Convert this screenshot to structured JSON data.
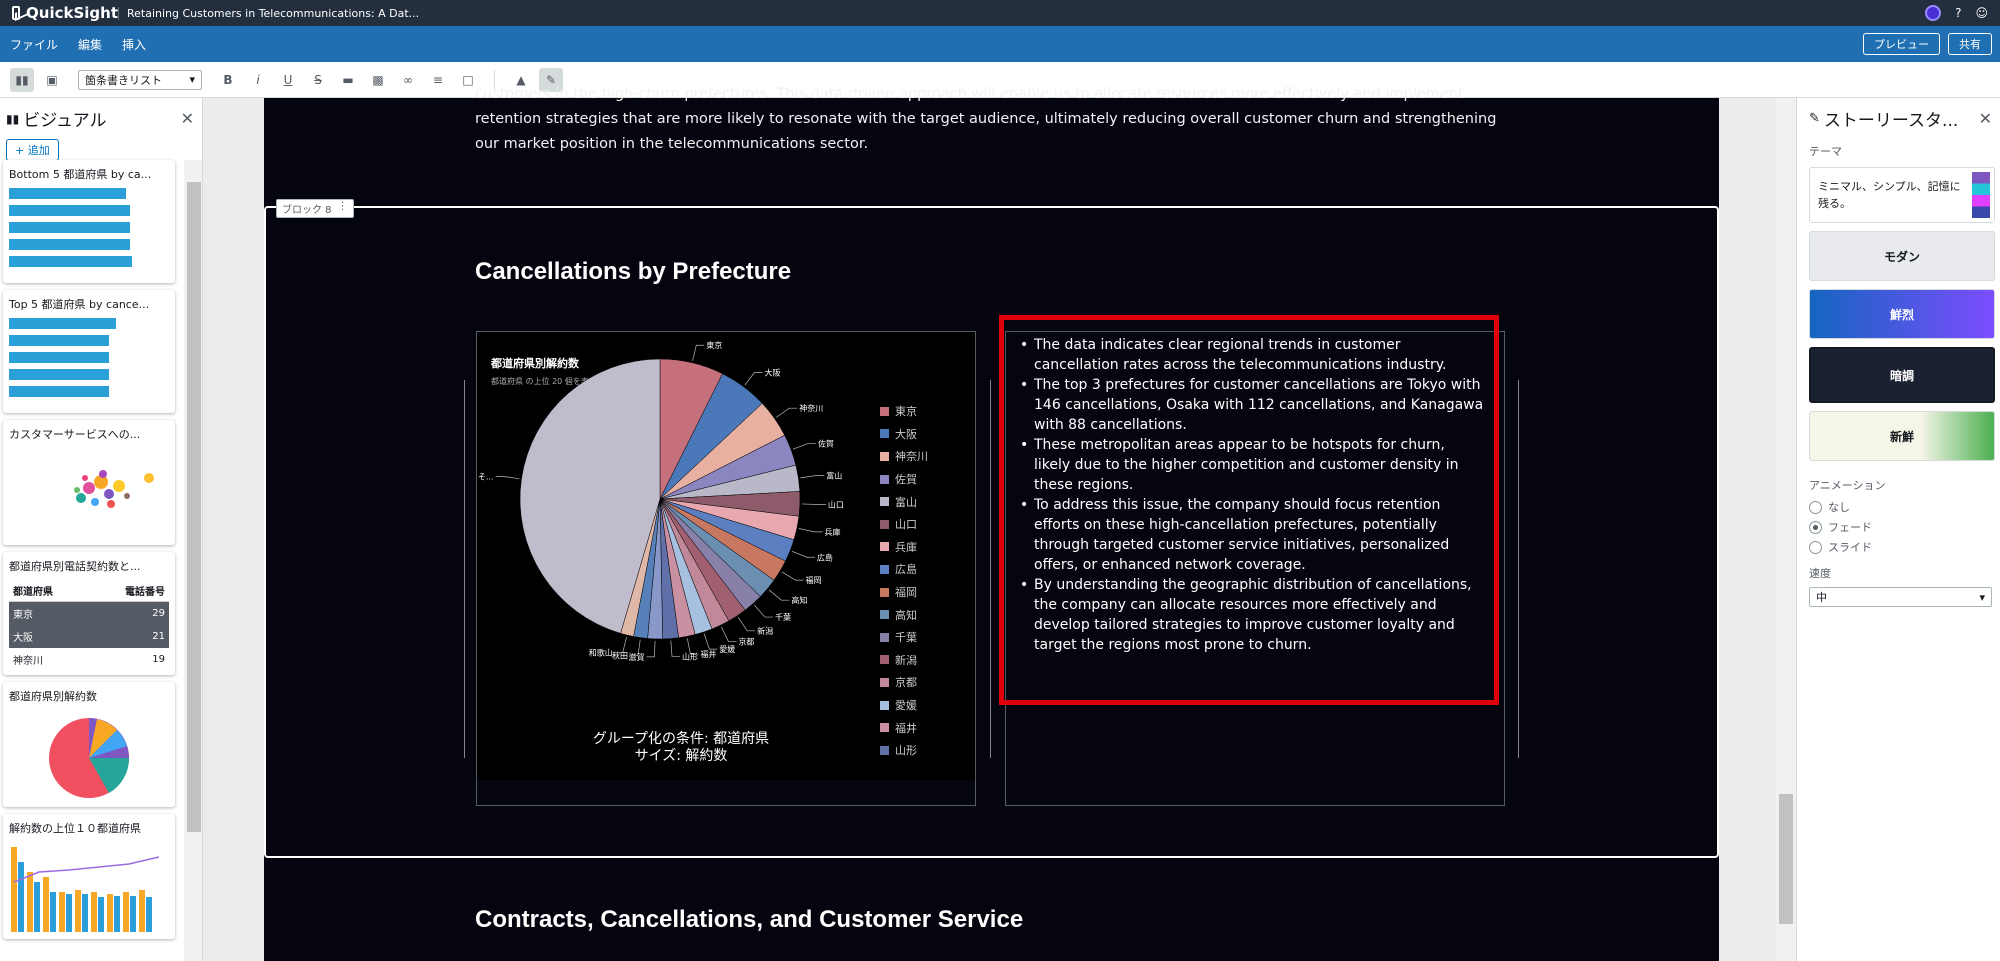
{
  "app": {
    "name": "QuickSight",
    "doc_title": "Retaining Customers in Telecommunications: A Dat..."
  },
  "menu": {
    "file": "ファイル",
    "edit": "編集",
    "insert": "挿入",
    "preview": "プレビュー",
    "share": "共有"
  },
  "toolbar": {
    "list_style": "箇条書きリスト",
    "bold": "B",
    "italic": "i",
    "underline": "U",
    "strike": "S"
  },
  "left_panel": {
    "title": "ビジュアル",
    "add_label": "+ 追加",
    "visuals": [
      "Bottom 5 都道府県 by ca...",
      "Top 5 都道府県 by cance...",
      "カスタマーサービスへの...",
      "都道府県別電話契約数と...",
      "都道府県別解約数",
      "解約数の上位１０都道府県"
    ],
    "table_headers": [
      "都道府県",
      "電話番号"
    ],
    "table_rows": [
      [
        "東京",
        "29"
      ],
      [
        "大阪",
        "21"
      ],
      [
        "神奈川",
        "19"
      ]
    ]
  },
  "story": {
    "intro": "customers in the high-churn prefectures. This data-driven approach will enable us to allocate resources more effectively and implement retention strategies that are more likely to resonate with the target audience, ultimately reducing overall customer churn and strengthening our market position in the telecommunications sector.",
    "block_tag": "ブロック 8",
    "section_title": "Cancellations by Prefecture",
    "next_section_title": "Contracts, Cancellations, and Customer Service",
    "bullets": [
      "The data indicates clear regional trends in customer cancellation rates across the telecommunications industry.",
      "The top 3 prefectures for customer cancellations are Tokyo with 146 cancellations, Osaka with 112 cancellations, and Kanagawa with 88 cancellations.",
      "These metropolitan areas appear to be hotspots for churn, likely due to the higher competition and customer density in these regions.",
      "To address this issue, the company should focus retention efforts on these high-cancellation prefectures, potentially through targeted customer service initiatives, personalized offers, or enhanced network coverage.",
      "By understanding the geographic distribution of cancellations, the company can allocate resources more effectively and develop tailored strategies to improve customer loyalty and target the regions most prone to churn."
    ]
  },
  "chart_data": {
    "type": "pie",
    "title": "都道府県別解約数",
    "subtitle": "都道府県 の上位 20 個を表示",
    "caption_line1": "グループ化の条件: 都道府県",
    "caption_line2": "サイズ: 解約数",
    "slices": [
      {
        "label": "東京",
        "value": 146,
        "color": "#c5707a"
      },
      {
        "label": "大阪",
        "value": 112,
        "color": "#4a78b8"
      },
      {
        "label": "神奈川",
        "value": 88,
        "color": "#e8b0a0"
      },
      {
        "label": "佐賀",
        "value": 72,
        "color": "#8b86c0"
      },
      {
        "label": "富山",
        "value": 60,
        "color": "#b8b8c8"
      },
      {
        "label": "山口",
        "value": 56,
        "color": "#8e5b6a"
      },
      {
        "label": "兵庫",
        "value": 54,
        "color": "#e8a8b0"
      },
      {
        "label": "広島",
        "value": 52,
        "color": "#5b7fc0"
      },
      {
        "label": "福岡",
        "value": 50,
        "color": "#c87860"
      },
      {
        "label": "高知",
        "value": 48,
        "color": "#6a8fb0"
      },
      {
        "label": "千葉",
        "value": 46,
        "color": "#8880a8"
      },
      {
        "label": "新潟",
        "value": 44,
        "color": "#a06070"
      },
      {
        "label": "京都",
        "value": 42,
        "color": "#c08898"
      },
      {
        "label": "愛媛",
        "value": 40,
        "color": "#a8c0e0"
      },
      {
        "label": "福井",
        "value": 38,
        "color": "#c890a0"
      },
      {
        "label": "山形",
        "value": 36,
        "color": "#6070a8"
      },
      {
        "label": "滋賀",
        "value": 34,
        "color": "#8898c8"
      },
      {
        "label": "秋田",
        "value": 32,
        "color": "#5880b8"
      },
      {
        "label": "和歌山",
        "value": 30,
        "color": "#e0b8a8"
      },
      {
        "label": "そ...",
        "value": 900,
        "color": "#c0bccc"
      }
    ]
  },
  "right_panel": {
    "title": "ストーリースタ...",
    "theme_label": "テーマ",
    "themes": [
      "ミニマル、シンプル、記憶に残る。",
      "モダン",
      "鮮烈",
      "暗調",
      "新鮮"
    ],
    "animation_label": "アニメーション",
    "animation_options": [
      "なし",
      "フェード",
      "スライド"
    ],
    "speed_label": "速度",
    "speed_value": "中"
  }
}
